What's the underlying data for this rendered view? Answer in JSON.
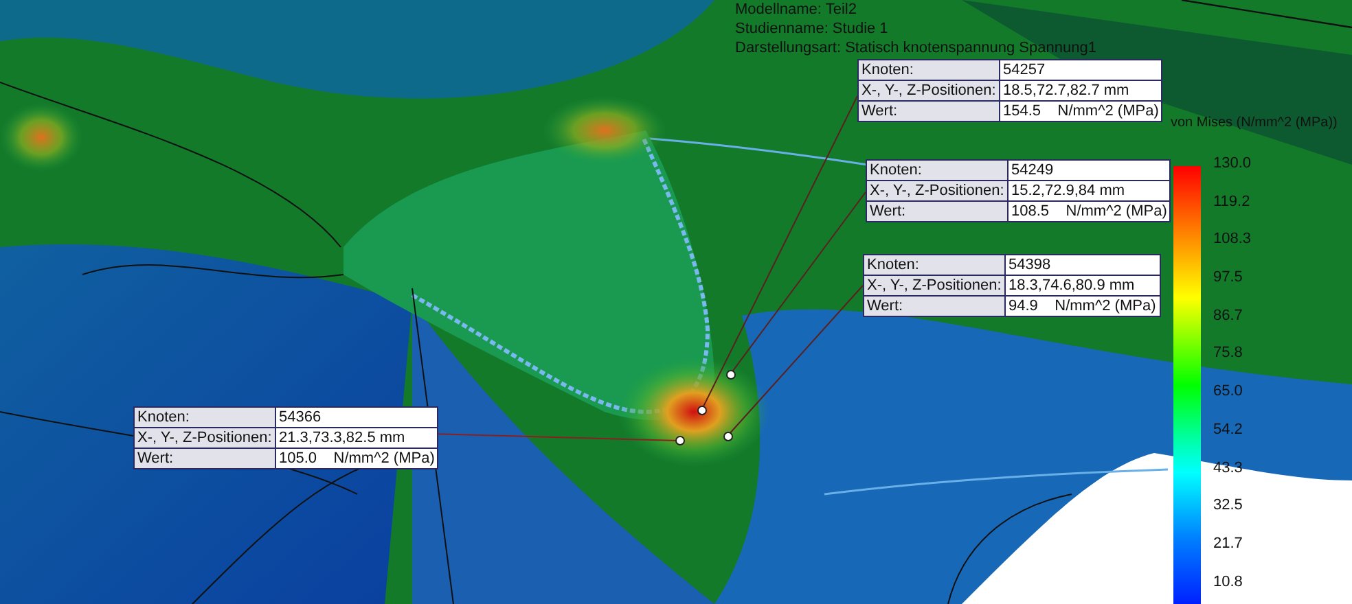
{
  "header": {
    "lines": [
      "Modellname: Teil2",
      "Studienname: Studie 1",
      "Darstellungsart: Statisch knotenspannung Spannung1"
    ]
  },
  "probes": [
    {
      "rows": [
        {
          "label": "Knoten:",
          "value": "54257"
        },
        {
          "label": "X-, Y-, Z-Positionen:",
          "value": "18.5,72.7,82.7 mm"
        },
        {
          "label": "Wert:",
          "value": "154.5    N/mm^2 (MPa)"
        }
      ]
    },
    {
      "rows": [
        {
          "label": "Knoten:",
          "value": "54249"
        },
        {
          "label": "X-, Y-, Z-Positionen:",
          "value": "15.2,72.9,84 mm"
        },
        {
          "label": "Wert:",
          "value": "108.5    N/mm^2 (MPa)"
        }
      ]
    },
    {
      "rows": [
        {
          "label": "Knoten:",
          "value": "54398"
        },
        {
          "label": "X-, Y-, Z-Positionen:",
          "value": "18.3,74.6,80.9 mm"
        },
        {
          "label": "Wert:",
          "value": "94.9    N/mm^2 (MPa)"
        }
      ]
    },
    {
      "rows": [
        {
          "label": "Knoten:",
          "value": "54366"
        },
        {
          "label": "X-, Y-, Z-Positionen:",
          "value": "21.3,73.3,82.5 mm"
        },
        {
          "label": "Wert:",
          "value": "105.0    N/mm^2 (MPa)"
        }
      ]
    }
  ],
  "legend": {
    "title": "von Mises (N/mm^2 (MPa))",
    "ticks": [
      "130.0",
      "119.2",
      "108.3",
      "97.5",
      "86.7",
      "75.8",
      "65.0",
      "54.2",
      "43.3",
      "32.5",
      "21.7",
      "10.8"
    ]
  }
}
